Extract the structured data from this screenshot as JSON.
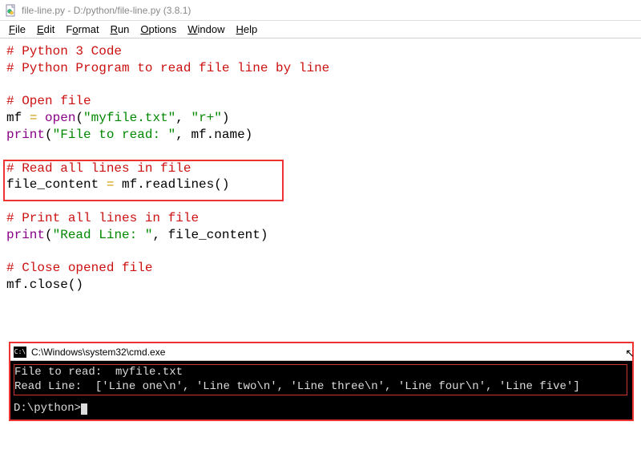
{
  "window": {
    "title": "file-line.py - D:/python/file-line.py (3.8.1)"
  },
  "menu": {
    "items": [
      "File",
      "Edit",
      "Format",
      "Run",
      "Options",
      "Window",
      "Help"
    ]
  },
  "code": {
    "l1": "# Python 3 Code",
    "l2": "# Python Program to read file line by line",
    "l3": "",
    "l4": "# Open file",
    "l5a": "mf ",
    "l5b": "=",
    "l5c": " open",
    "l5d": "(",
    "l5e": "\"myfile.txt\"",
    "l5f": ", ",
    "l5g": "\"r+\"",
    "l5h": ")",
    "l6a": "print",
    "l6b": "(",
    "l6c": "\"File to read: \"",
    "l6d": ", mf.name)",
    "l7": "",
    "l8": "# Read all lines in file",
    "l9a": "file_content ",
    "l9b": "=",
    "l9c": " mf.readlines()",
    "l10": "",
    "l11": "# Print all lines in file",
    "l12a": "print",
    "l12b": "(",
    "l12c": "\"Read Line: \"",
    "l12d": ", file_content)",
    "l13": "",
    "l14": "# Close opened file",
    "l15": "mf.close()"
  },
  "terminal": {
    "title": "C:\\Windows\\system32\\cmd.exe",
    "out1": "File to read:  myfile.txt",
    "out2": "Read Line:  ['Line one\\n', 'Line two\\n', 'Line three\\n', 'Line four\\n', 'Line five']",
    "prompt": "D:\\python>"
  }
}
